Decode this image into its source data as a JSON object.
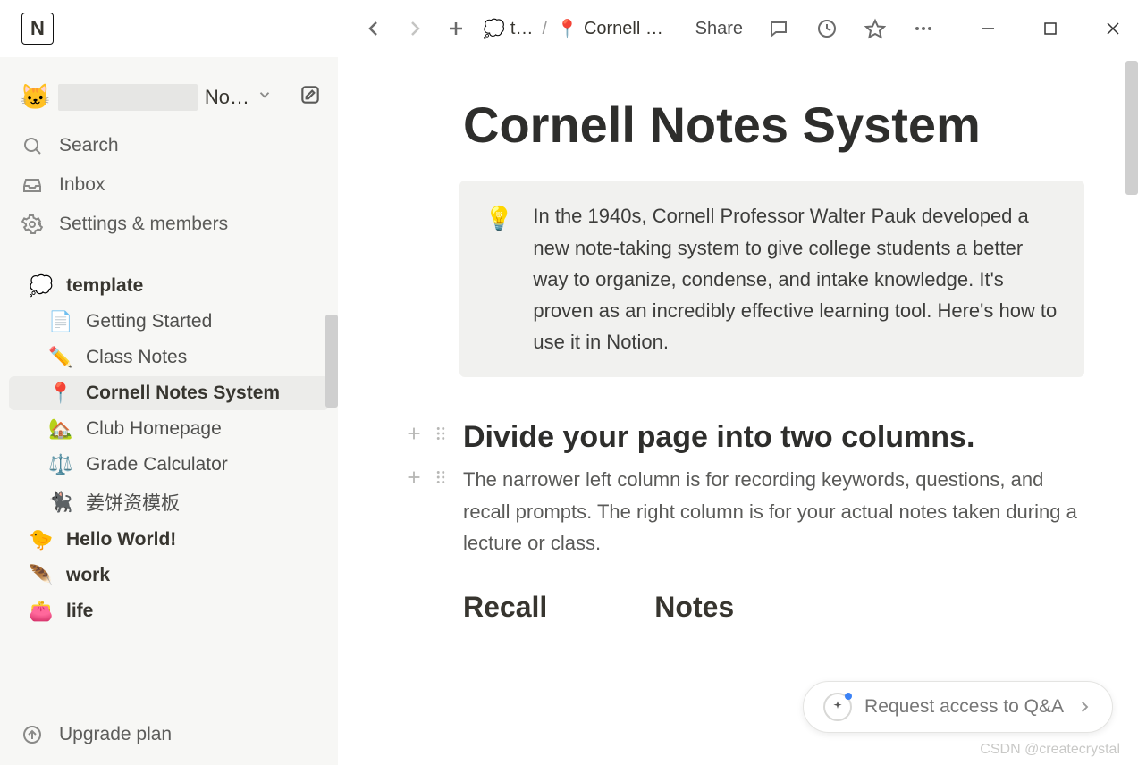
{
  "topbar": {
    "logo_text": "N",
    "breadcrumb": {
      "root_icon": "💭",
      "root_label": "t…",
      "separator": "/",
      "page_icon": "📍",
      "page_label": "Cornell …"
    },
    "share_label": "Share"
  },
  "workspace": {
    "avatar": "🐱",
    "suffix": "No…"
  },
  "sidebar": {
    "search": "Search",
    "inbox": "Inbox",
    "settings": "Settings & members",
    "pages": [
      {
        "emoji": "💭",
        "label": "template",
        "bold": true,
        "child": false,
        "selected": false,
        "icon_name": "thought-balloon-icon"
      },
      {
        "emoji": "📄",
        "label": "Getting Started",
        "bold": false,
        "child": true,
        "selected": false,
        "icon_name": "page-icon"
      },
      {
        "emoji": "✏️",
        "label": "Class Notes",
        "bold": false,
        "child": true,
        "selected": false,
        "icon_name": "pencil-icon"
      },
      {
        "emoji": "📍",
        "label": "Cornell Notes System",
        "bold": true,
        "child": true,
        "selected": true,
        "icon_name": "round-pushpin-icon"
      },
      {
        "emoji": "🏡",
        "label": "Club Homepage",
        "bold": false,
        "child": true,
        "selected": false,
        "icon_name": "house-garden-icon"
      },
      {
        "emoji": "⚖️",
        "label": "Grade Calculator",
        "bold": false,
        "child": true,
        "selected": false,
        "icon_name": "scales-icon"
      },
      {
        "emoji": "🐈‍⬛",
        "label": "姜饼资模板",
        "bold": false,
        "child": true,
        "selected": false,
        "icon_name": "black-cat-icon"
      },
      {
        "emoji": "🐤",
        "label": "Hello World!",
        "bold": true,
        "child": false,
        "selected": false,
        "icon_name": "baby-chick-icon"
      },
      {
        "emoji": "🪶",
        "label": "work",
        "bold": true,
        "child": false,
        "selected": false,
        "icon_name": "feather-icon"
      },
      {
        "emoji": "👛",
        "label": "life",
        "bold": true,
        "child": false,
        "selected": false,
        "icon_name": "purse-icon"
      }
    ],
    "upgrade": "Upgrade plan"
  },
  "page": {
    "title": "Cornell Notes System",
    "callout_icon": "💡",
    "callout_text": "In the 1940s, Cornell Professor Walter Pauk developed a new note-taking system to give college students a better way to organize, condense, and intake knowledge. It's proven as an incredibly effective learning tool. Here's how to use it in Notion.",
    "section_heading": "Divide your page into two columns.",
    "section_body": "The narrower left column is for recording keywords, questions, and recall prompts. The right column is for your actual notes taken during a lecture or class.",
    "col_left": "Recall",
    "col_right": "Notes"
  },
  "qa": {
    "label": "Request access to Q&A"
  },
  "watermark": "CSDN @createcrystal"
}
